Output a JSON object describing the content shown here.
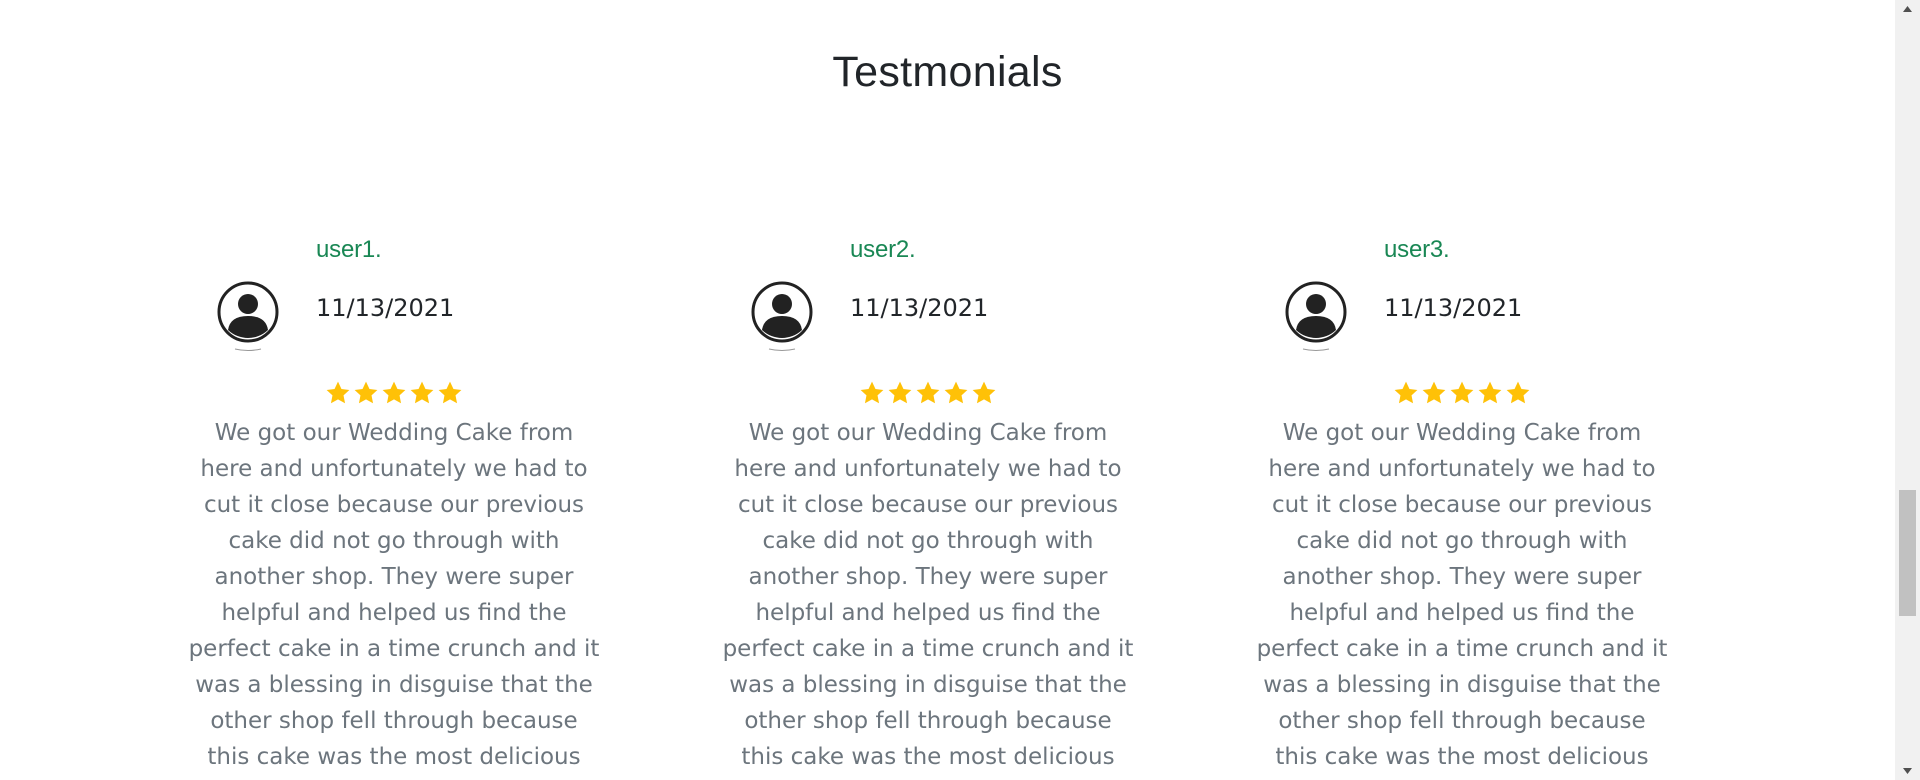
{
  "section": {
    "title": "Testmonials"
  },
  "testimonials": [
    {
      "user": "user1.",
      "date": "11/13/2021",
      "rating": 5,
      "text": "We got our Wedding Cake from here and unfortunately we had to cut it close because our previous cake did not go through with another shop. They were super helpful and helped us find the perfect cake in a time crunch and it was a blessing in disguise that the other shop fell through because this cake was the most delicious"
    },
    {
      "user": "user2.",
      "date": "11/13/2021",
      "rating": 5,
      "text": "We got our Wedding Cake from here and unfortunately we had to cut it close because our previous cake did not go through with another shop. They were super helpful and helped us find the perfect cake in a time crunch and it was a blessing in disguise that the other shop fell through because this cake was the most delicious"
    },
    {
      "user": "user3.",
      "date": "11/13/2021",
      "rating": 5,
      "text": "We got our Wedding Cake from here and unfortunately we had to cut it close because our previous cake did not go through with another shop. They were super helpful and helped us find the perfect cake in a time crunch and it was a blessing in disguise that the other shop fell through because this cake was the most delicious"
    }
  ],
  "colors": {
    "user_name": "#198754",
    "star": "#ffc107",
    "body_text": "#6c757d",
    "heading": "#212529"
  },
  "icons": {
    "avatar": "user-avatar-icon",
    "star": "star-icon",
    "scroll_up": "chevron-up-icon",
    "scroll_down": "chevron-down-icon"
  },
  "scroll_position": 0.79
}
